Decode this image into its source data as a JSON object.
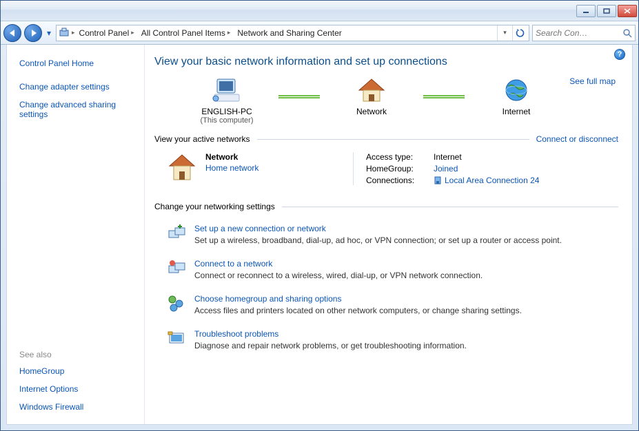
{
  "window": {
    "breadcrumbs": [
      "Control Panel",
      "All Control Panel Items",
      "Network and Sharing Center"
    ],
    "search_placeholder": "Search Con…"
  },
  "sidebar": {
    "home": "Control Panel Home",
    "links": [
      "Change adapter settings",
      "Change advanced sharing settings"
    ],
    "see_also_label": "See also",
    "see_also": [
      "HomeGroup",
      "Internet Options",
      "Windows Firewall"
    ]
  },
  "main": {
    "title": "View your basic network information and set up connections",
    "see_full_map": "See full map",
    "nodes": {
      "computer_name": "ENGLISH-PC",
      "computer_sub": "(This computer)",
      "network_label": "Network",
      "internet_label": "Internet"
    },
    "active_header": "View your active networks",
    "connect_disconnect": "Connect or disconnect",
    "network": {
      "name": "Network",
      "type": "Home network",
      "access_type_label": "Access type:",
      "access_type_value": "Internet",
      "homegroup_label": "HomeGroup:",
      "homegroup_value": "Joined",
      "connections_label": "Connections:",
      "connections_value": "Local Area Connection 24"
    },
    "change_header": "Change your networking settings",
    "settings": [
      {
        "title": "Set up a new connection or network",
        "desc": "Set up a wireless, broadband, dial-up, ad hoc, or VPN connection; or set up a router or access point."
      },
      {
        "title": "Connect to a network",
        "desc": "Connect or reconnect to a wireless, wired, dial-up, or VPN network connection."
      },
      {
        "title": "Choose homegroup and sharing options",
        "desc": "Access files and printers located on other network computers, or change sharing settings."
      },
      {
        "title": "Troubleshoot problems",
        "desc": "Diagnose and repair network problems, or get troubleshooting information."
      }
    ]
  }
}
